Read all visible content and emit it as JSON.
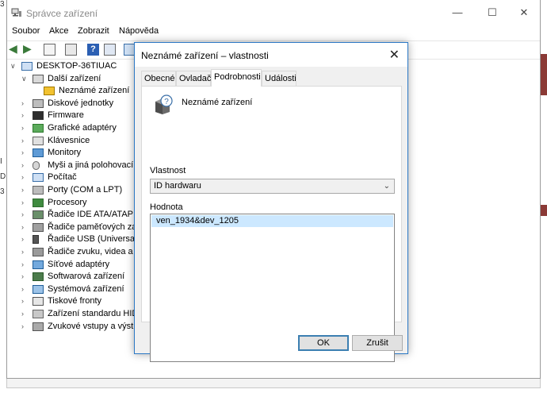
{
  "window": {
    "title": "Správce zařízení",
    "controls": [
      "—",
      "☐",
      "✕"
    ]
  },
  "menu": [
    "Soubor",
    "Akce",
    "Zobrazit",
    "Nápověda"
  ],
  "left_edge_chars": [
    "3",
    "I",
    "D",
    "3"
  ],
  "tree": [
    {
      "label": "DESKTOP-36TIUAC",
      "icon": "computer-icon",
      "level": 0,
      "expanded": true
    },
    {
      "label": "Další zařízení",
      "icon": "other-devices-icon",
      "level": 1,
      "expanded": true
    },
    {
      "label": "Neznámé zařízení",
      "icon": "unknown-device-warning-icon",
      "level": 2
    },
    {
      "label": "Diskové jednotky",
      "icon": "disk-drive-icon",
      "level": 1
    },
    {
      "label": "Firmware",
      "icon": "firmware-icon",
      "level": 1
    },
    {
      "label": "Grafické adaptéry",
      "icon": "display-adapter-icon",
      "level": 1
    },
    {
      "label": "Klávesnice",
      "icon": "keyboard-icon",
      "level": 1
    },
    {
      "label": "Monitory",
      "icon": "monitor-icon",
      "level": 1
    },
    {
      "label": "Myši a jiná polohovací z",
      "icon": "mouse-icon",
      "level": 1
    },
    {
      "label": "Počítač",
      "icon": "computer-icon",
      "level": 1
    },
    {
      "label": "Porty (COM a LPT)",
      "icon": "port-icon",
      "level": 1
    },
    {
      "label": "Procesory",
      "icon": "processor-icon",
      "level": 1
    },
    {
      "label": "Řadiče IDE ATA/ATAPI",
      "icon": "ide-controller-icon",
      "level": 1
    },
    {
      "label": "Řadiče paměťových zaří",
      "icon": "storage-controller-icon",
      "level": 1
    },
    {
      "label": "Řadiče USB (Universal Se",
      "icon": "usb-icon",
      "level": 1
    },
    {
      "label": "Řadiče zvuku, videa a he",
      "icon": "sound-icon",
      "level": 1
    },
    {
      "label": "Síťové adaptéry",
      "icon": "network-adapter-icon",
      "level": 1
    },
    {
      "label": "Softwarová zařízení",
      "icon": "software-device-icon",
      "level": 1
    },
    {
      "label": "Systémová zařízení",
      "icon": "system-device-icon",
      "level": 1
    },
    {
      "label": "Tiskové fronty",
      "icon": "printer-icon",
      "level": 1
    },
    {
      "label": "Zařízení standardu HID",
      "icon": "hid-icon",
      "level": 1
    },
    {
      "label": "Zvukové vstupy a výstup",
      "icon": "audio-io-icon",
      "level": 1
    }
  ],
  "dialog": {
    "title": "Neznámé zařízení – vlastnosti",
    "tabs": [
      "Obecné",
      "Ovladač",
      "Podrobnosti",
      "Události"
    ],
    "active_tab": "Podrobnosti",
    "device_name": "Neznámé zařízení",
    "property_label": "Vlastnost",
    "property_value": "ID hardwaru",
    "value_label": "Hodnota",
    "values": [
      "ven_1934&dev_1205"
    ],
    "ok_label": "OK",
    "cancel_label": "Zrušit",
    "close_glyph": "✕"
  },
  "colors": {
    "accent": "#2b78c5",
    "selection": "#cce8ff",
    "background_strip": "#8b3a36"
  }
}
